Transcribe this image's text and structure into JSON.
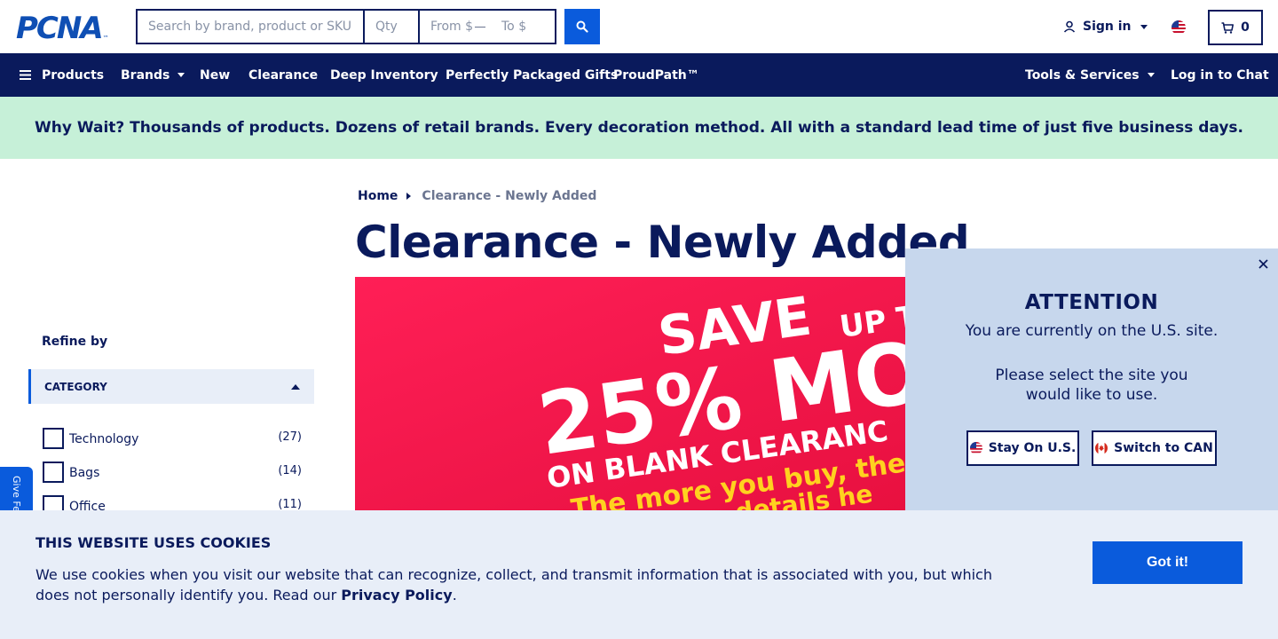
{
  "logo": {
    "text": "PCNA",
    "tm": "™"
  },
  "search": {
    "query_placeholder": "Search by brand, product or SKU",
    "qty_placeholder": "Qty",
    "from_placeholder": "From $",
    "to_placeholder": "To $"
  },
  "account": {
    "signin_label": "Sign in",
    "cart_count": "0"
  },
  "nav": {
    "products": "Products",
    "brands": "Brands",
    "new": "New",
    "clearance": "Clearance",
    "deep_inventory": "Deep Inventory",
    "gifts": "Perfectly Packaged Gifts",
    "proudpath": "ProudPath™",
    "tools": "Tools & Services",
    "chat": "Log in to Chat"
  },
  "banner": {
    "text": "Why Wait? Thousands of products. Dozens of retail brands. Every decoration method. All with a standard lead time of just five business days."
  },
  "breadcrumb": {
    "home": "Home",
    "current": "Clearance - Newly Added"
  },
  "page": {
    "title": "Clearance - Newly Added"
  },
  "hero": {
    "line1": "SAVE",
    "line1b": "UP T",
    "line2": "25% MO",
    "line3": "ON BLANK CLEARANC",
    "line4": "The more you buy, the mo",
    "line5": "details he"
  },
  "sidebar": {
    "refine_label": "Refine by",
    "category_label": "CATEGORY",
    "filters": [
      {
        "label": "Technology",
        "count": "(27)"
      },
      {
        "label": "Bags",
        "count": "(14)"
      },
      {
        "label": "Office",
        "count": "(11)"
      }
    ],
    "feedback_label": "Give Fe"
  },
  "modal": {
    "title": "ATTENTION",
    "line1": "You are currently on the U.S. site.",
    "line2": "Please select the site you would like to use.",
    "stay_label": "Stay On U.S.",
    "switch_label": "Switch to CAN"
  },
  "cookies": {
    "heading": "THIS WEBSITE USES COOKIES",
    "body": "We use cookies when you visit our website that can recognize, collect, and transmit information that is associated with you, but which does not personally identify you. Read our ",
    "link": "Privacy Policy",
    "end": ".",
    "button": "Got it!"
  },
  "colors": {
    "navy": "#0a1a5c",
    "blue": "#0a5bdc",
    "banner_green": "#c6f0d8",
    "modal_bg": "#c7d7ed",
    "cookie_bg": "#e8eef8",
    "hero_red": "#f01649"
  },
  "icons": {
    "search": "search-icon",
    "user": "user-icon",
    "flag_us": "us-flag-icon",
    "flag_ca": "canada-flag-icon",
    "cart": "cart-icon",
    "menu": "hamburger-icon",
    "close": "close-icon"
  }
}
